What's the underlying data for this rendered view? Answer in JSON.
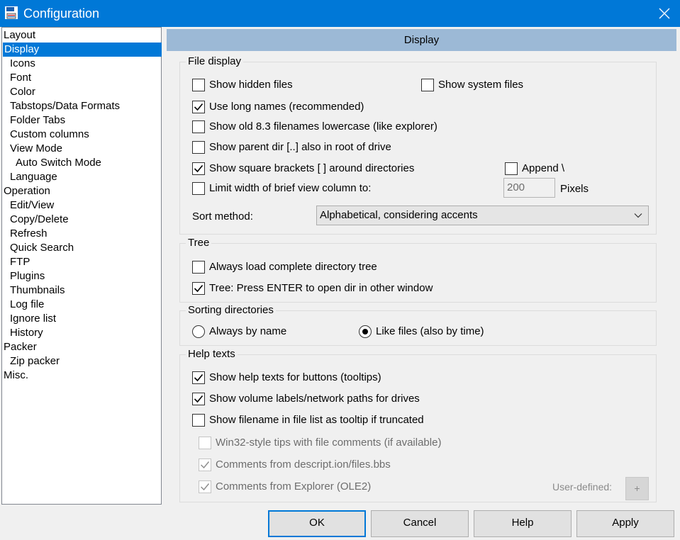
{
  "window": {
    "title": "Configuration",
    "app_icon": "floppy-disk-icon",
    "close_icon": "close-icon"
  },
  "tree": {
    "items": [
      {
        "label": "Layout"
      },
      {
        "label": "Display",
        "selected": true
      },
      {
        "label": "Icons"
      },
      {
        "label": "Font"
      },
      {
        "label": "Color"
      },
      {
        "label": "Tabstops/Data Formats"
      },
      {
        "label": "Folder Tabs"
      },
      {
        "label": "Custom columns"
      },
      {
        "label": "View Mode"
      },
      {
        "label": "Auto Switch Mode"
      },
      {
        "label": "Language"
      },
      {
        "label": "Operation"
      },
      {
        "label": "Edit/View"
      },
      {
        "label": "Copy/Delete"
      },
      {
        "label": "Refresh"
      },
      {
        "label": "Quick Search"
      },
      {
        "label": "FTP"
      },
      {
        "label": "Plugins"
      },
      {
        "label": "Thumbnails"
      },
      {
        "label": "Log file"
      },
      {
        "label": "Ignore list"
      },
      {
        "label": "History"
      },
      {
        "label": "Packer"
      },
      {
        "label": "Zip packer"
      },
      {
        "label": "Misc."
      }
    ]
  },
  "panel": {
    "header": "Display"
  },
  "file_display": {
    "legend": "File display",
    "show_hidden": {
      "label": "Show hidden files",
      "checked": false
    },
    "show_system": {
      "label": "Show system files",
      "checked": false
    },
    "long_names": {
      "label": "Use long names (recommended)",
      "checked": true
    },
    "old_83": {
      "label": "Show old 8.3 filenames lowercase (like explorer)",
      "checked": false
    },
    "parent_dir": {
      "label": "Show parent dir [..] also in root of drive",
      "checked": false
    },
    "square_brackets": {
      "label": "Show square brackets [ ] around directories",
      "checked": true
    },
    "append": {
      "label": "Append \\",
      "checked": false
    },
    "limit_width": {
      "label": "Limit width of brief view column to:",
      "checked": false
    },
    "width_value": "200",
    "width_unit": "Pixels",
    "sort_label": "Sort method:",
    "sort_value": "Alphabetical, considering accents"
  },
  "tree_group": {
    "legend": "Tree",
    "always_load": {
      "label": "Always load complete directory tree",
      "checked": false
    },
    "press_enter": {
      "label": "Tree: Press ENTER to open dir in other window",
      "checked": true
    }
  },
  "sorting": {
    "legend": "Sorting directories",
    "by_name": {
      "label": "Always by name",
      "selected": false
    },
    "like_files": {
      "label": "Like files (also by time)",
      "selected": true
    }
  },
  "help_texts": {
    "legend": "Help texts",
    "tooltips": {
      "label": "Show help texts for buttons (tooltips)",
      "checked": true
    },
    "volume_labels": {
      "label": "Show volume labels/network paths for drives",
      "checked": true
    },
    "filename_tooltip": {
      "label": "Show filename in file list as tooltip if truncated",
      "checked": false
    },
    "win32_tips": {
      "label": "Win32-style tips with file comments (if available)",
      "checked": false
    },
    "descript": {
      "label": "Comments from descript.ion/files.bbs",
      "checked": true
    },
    "explorer_comments": {
      "label": "Comments from Explorer (OLE2)",
      "checked": true
    },
    "user_defined_label": "User-defined:",
    "user_defined_button": "+"
  },
  "buttons": {
    "ok": "OK",
    "cancel": "Cancel",
    "help": "Help",
    "apply": "Apply"
  }
}
